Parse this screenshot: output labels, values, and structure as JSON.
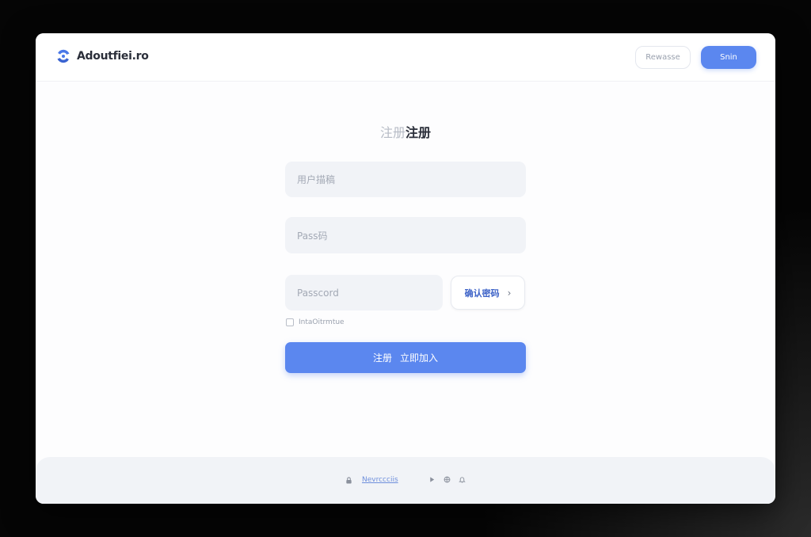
{
  "header": {
    "brand_name": "Adoutfiei.ro",
    "secondary_button_label": "Rewasse",
    "primary_button_label": "Snin"
  },
  "form": {
    "title_faded": "注册",
    "title_strong": "注册",
    "username_placeholder": "用户描稿",
    "password_placeholder": "Pass码",
    "confirm_placeholder": "Passcord",
    "confirm_button_label": "确认密码",
    "checkbox_label": "IntaOitrmtue",
    "submit_label_a": "注册",
    "submit_label_b": "立即加入"
  },
  "footer": {
    "link_text": "Nevrccciis"
  },
  "colors": {
    "accent": "#5b87ef",
    "field_bg": "#f1f3f7",
    "page_bg": "#050505"
  },
  "icons": [
    "brand-logo-icon",
    "lock-icon",
    "play-icon",
    "globe-icon",
    "bell-icon",
    "chevron-right-icon"
  ]
}
